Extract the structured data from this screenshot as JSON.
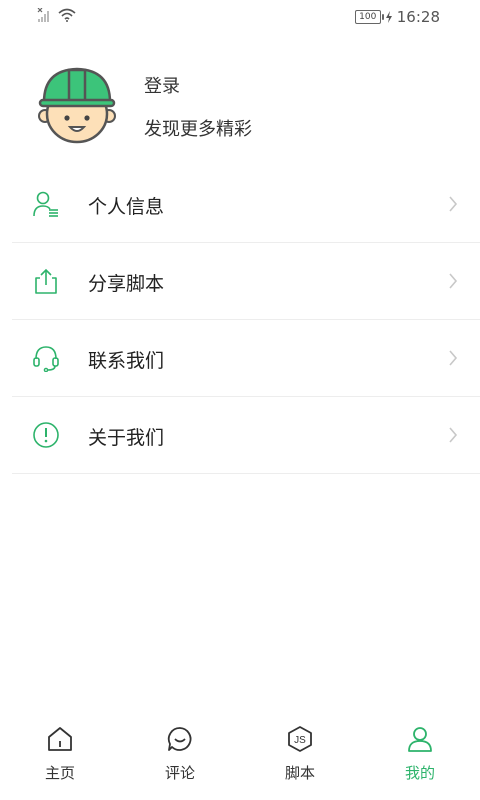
{
  "colors": {
    "accent": "#2db36b",
    "text": "#333333",
    "divider": "#ededed"
  },
  "status_bar": {
    "battery_level": "100",
    "time": "16:28",
    "icons": [
      "no-sim-icon",
      "signal-icon",
      "wifi-icon",
      "battery-icon",
      "charging-icon"
    ]
  },
  "profile": {
    "login_label": "登录",
    "subtitle": "发现更多精彩",
    "avatar_icon": "worker-avatar-icon"
  },
  "menu": {
    "items": [
      {
        "label": "个人信息",
        "icon": "person-info-icon"
      },
      {
        "label": "分享脚本",
        "icon": "share-icon"
      },
      {
        "label": "联系我们",
        "icon": "headset-icon"
      },
      {
        "label": "关于我们",
        "icon": "info-icon"
      }
    ]
  },
  "tabbar": {
    "tabs": [
      {
        "label": "主页",
        "icon": "home-icon",
        "active": false
      },
      {
        "label": "评论",
        "icon": "comment-icon",
        "active": false
      },
      {
        "label": "脚本",
        "icon": "js-script-icon",
        "active": false
      },
      {
        "label": "我的",
        "icon": "profile-icon",
        "active": true
      }
    ]
  }
}
